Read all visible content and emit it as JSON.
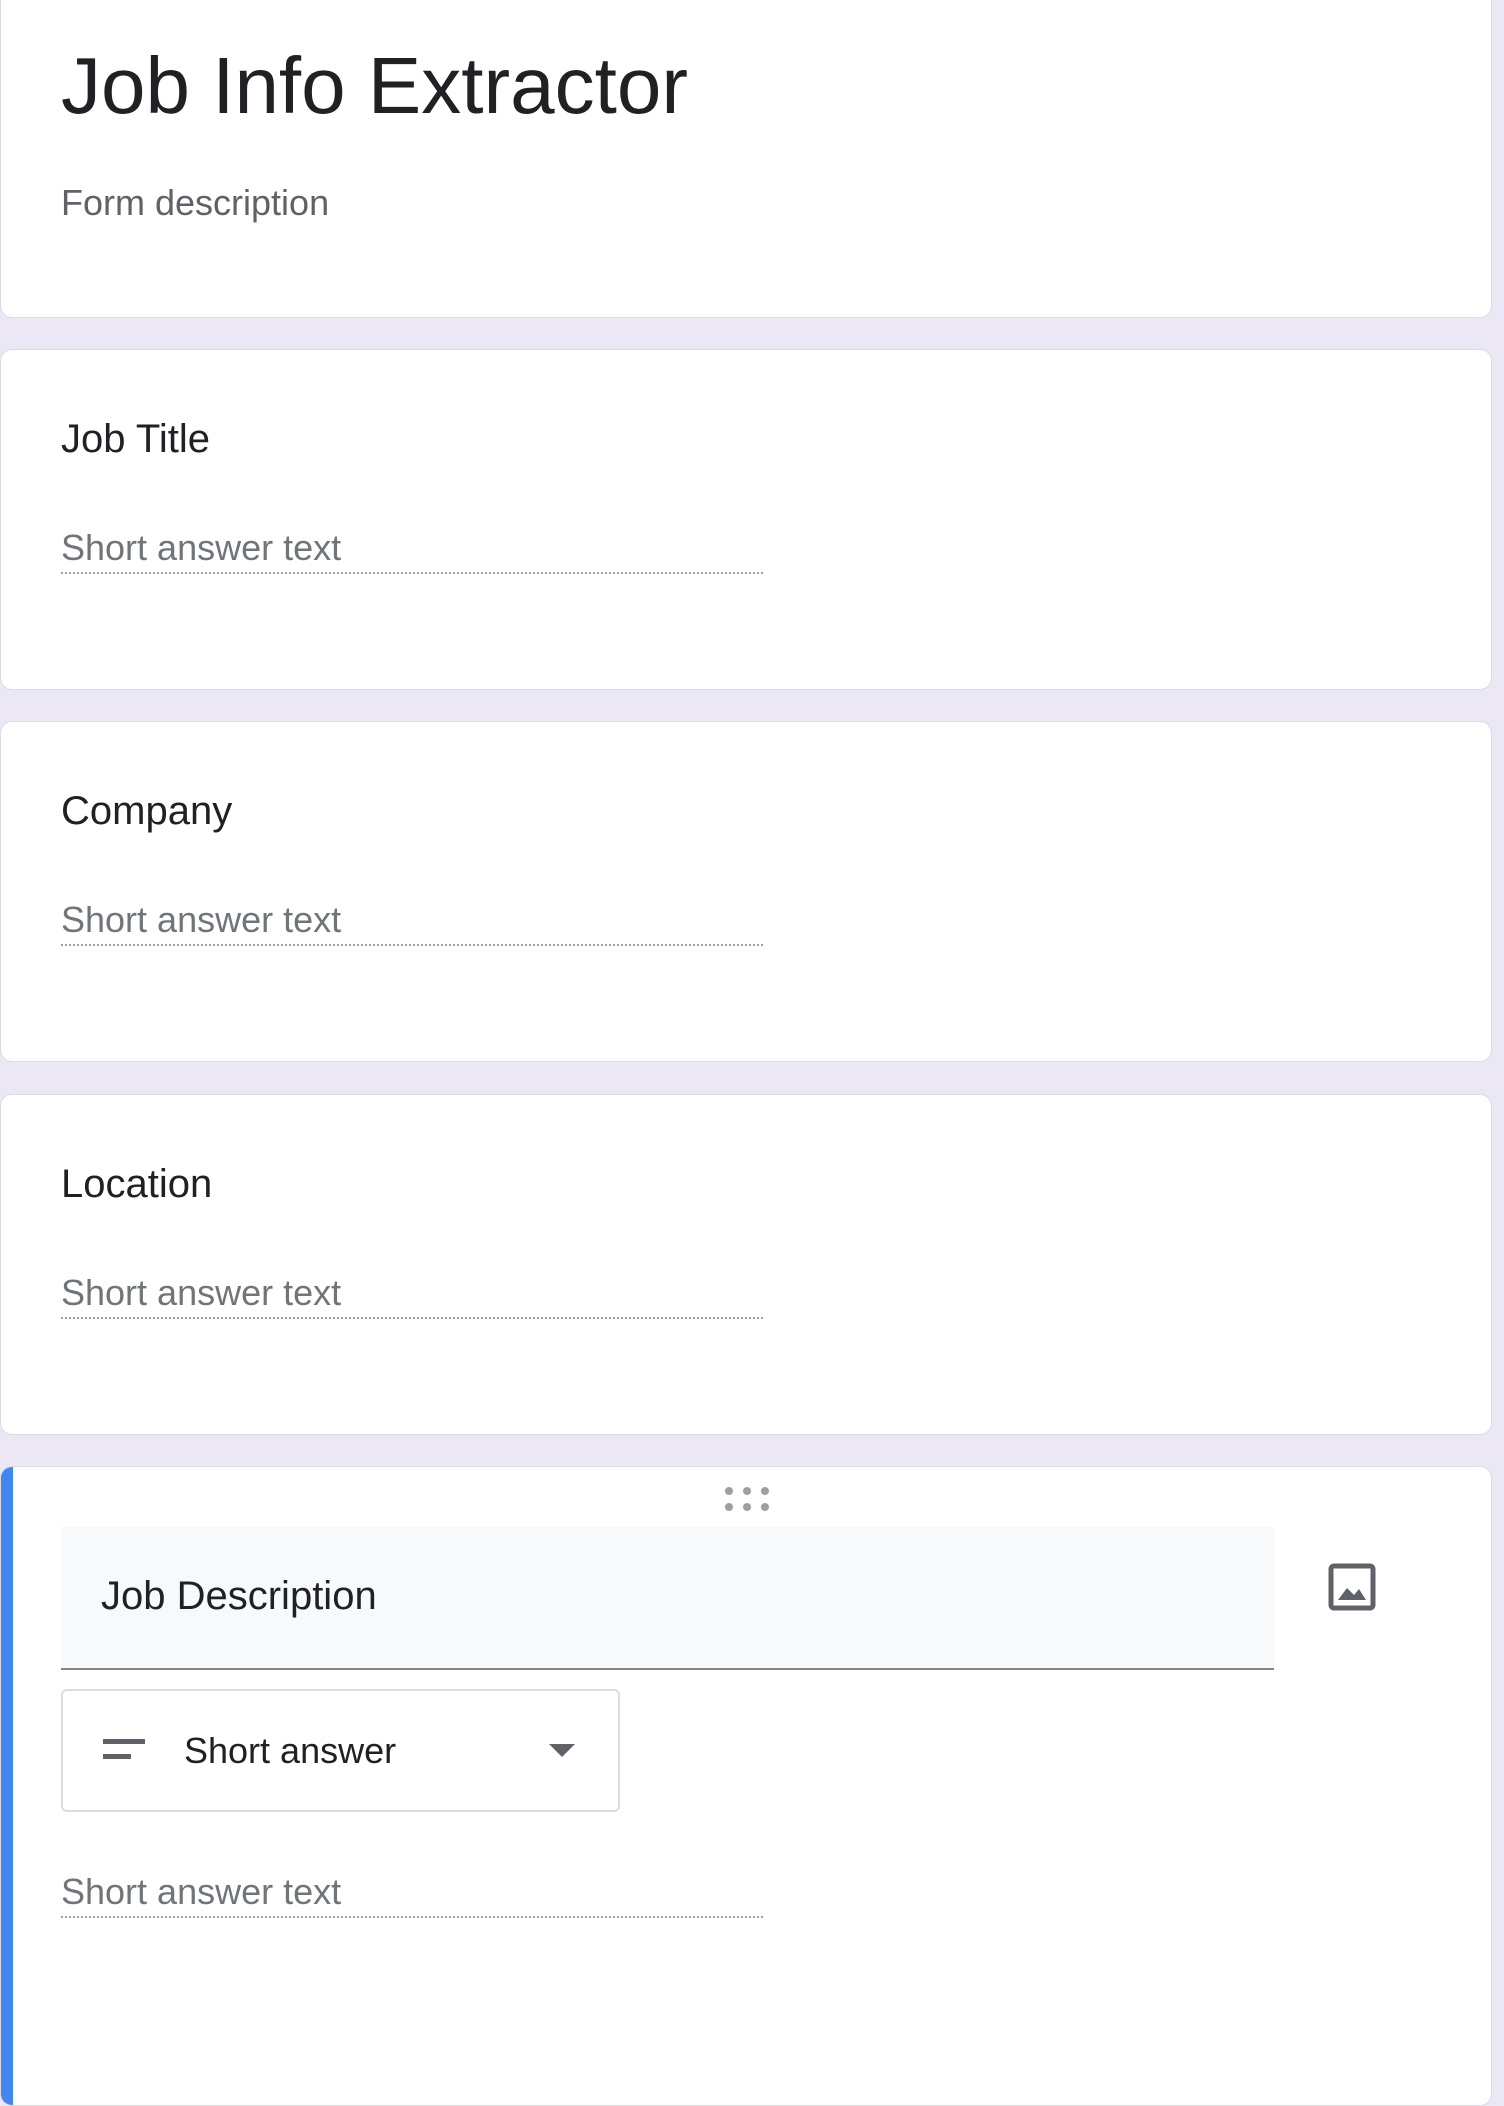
{
  "form": {
    "title": "Job Info Extractor",
    "description_placeholder": "Form description"
  },
  "questions": [
    {
      "title": "Job Title",
      "answer_placeholder": "Short answer text"
    },
    {
      "title": "Company",
      "answer_placeholder": "Short answer text"
    },
    {
      "title": "Location",
      "answer_placeholder": "Short answer text"
    }
  ],
  "active_question": {
    "title": "Job Description",
    "type_label": "Short answer",
    "type_icon": "short-text-icon",
    "answer_placeholder": "Short answer text"
  },
  "colors": {
    "background": "#ebe7f5",
    "accent": "#673ab7",
    "active_bar": "#4285f4"
  }
}
